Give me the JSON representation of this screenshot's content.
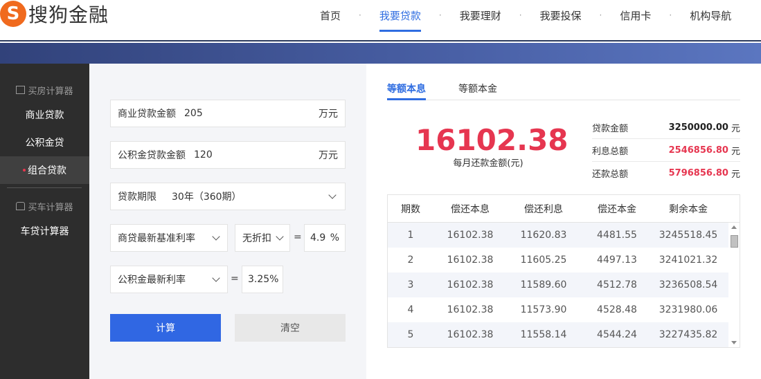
{
  "header": {
    "logo_badge": "S",
    "logo_text": "搜狗金融",
    "nav": [
      {
        "label": "首页"
      },
      {
        "label": "我要贷款"
      },
      {
        "label": "我要理财"
      },
      {
        "label": "我要投保"
      },
      {
        "label": "信用卡"
      },
      {
        "label": "机构导航"
      }
    ],
    "nav_sep": "·"
  },
  "sidebar": {
    "group1": "买房计算器",
    "items": [
      {
        "label": "商业贷款"
      },
      {
        "label": "公积金贷"
      },
      {
        "label": "组合贷款"
      }
    ],
    "group2": "买车计算器",
    "car_item": "车贷计算器"
  },
  "form": {
    "commercial": {
      "label": "商业贷款金额",
      "value": "205",
      "unit": "万元"
    },
    "fund": {
      "label": "公积金贷款金额",
      "value": "120",
      "unit": "万元"
    },
    "term": {
      "label": "贷款期限",
      "value": "30年（360期）"
    },
    "rate": {
      "label": "商贷最新基准利率",
      "discount": "无折扣",
      "eq": "=",
      "value": "4.9",
      "unit": "%"
    },
    "fund_rate": {
      "label": "公积金最新利率",
      "eq": "=",
      "value": "3.25%"
    },
    "calc_button": "计算",
    "clear_button": "清空"
  },
  "result": {
    "tabs": [
      {
        "label": "等额本息"
      },
      {
        "label": "等额本金"
      }
    ],
    "monthly_value": "16102.38",
    "monthly_caption": "每月还款金额(元)",
    "summary": [
      {
        "label": "贷款金额",
        "value": "3250000.00",
        "unit": "元"
      },
      {
        "label": "利息总额",
        "value": "2546856.80",
        "unit": "元"
      },
      {
        "label": "还款总额",
        "value": "5796856.80",
        "unit": "元"
      }
    ],
    "table": {
      "headers": [
        "期数",
        "偿还本息",
        "偿还利息",
        "偿还本金",
        "剩余本金"
      ],
      "rows": [
        [
          "1",
          "16102.38",
          "11620.83",
          "4481.55",
          "3245518.45"
        ],
        [
          "2",
          "16102.38",
          "11605.25",
          "4497.13",
          "3241021.32"
        ],
        [
          "3",
          "16102.38",
          "11589.60",
          "4512.78",
          "3236508.54"
        ],
        [
          "4",
          "16102.38",
          "11573.90",
          "4528.48",
          "3231980.06"
        ],
        [
          "5",
          "16102.38",
          "11558.14",
          "4544.24",
          "3227435.82"
        ]
      ]
    }
  },
  "colors": {
    "accent": "#2f6de1",
    "highlight": "#e63650",
    "brand": "#f06a1e",
    "sidebar": "#2d2d2d"
  }
}
